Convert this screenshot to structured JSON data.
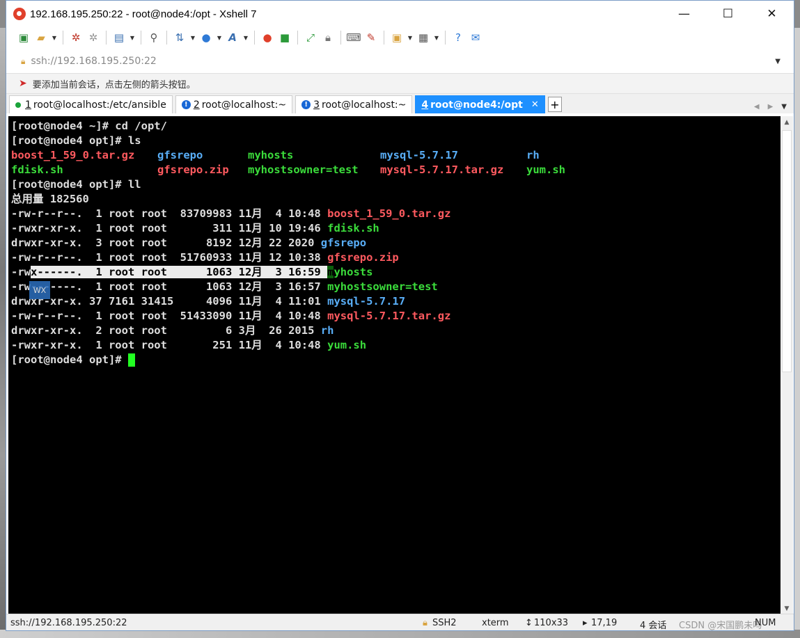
{
  "window": {
    "title": "192.168.195.250:22 - root@node4:/opt - Xshell 7",
    "minimize": "—",
    "maximize": "☐",
    "close": "✕"
  },
  "toolbar": {
    "icons": [
      "new-session-icon",
      "open-folder-icon",
      "connect-icon",
      "disconnect-icon",
      "properties-icon",
      "find-icon",
      "transfer-icon",
      "globe-icon",
      "font-icon",
      "xftp-icon",
      "xshell-green-icon",
      "fullscreen-icon",
      "lock-icon",
      "keyboard-icon",
      "highlight-icon",
      "compose-icon",
      "layout-icon",
      "help-icon",
      "chat-icon"
    ]
  },
  "address": {
    "value": "ssh://192.168.195.250:22"
  },
  "notice": {
    "text": "要添加当前会话，点击左侧的箭头按钮。"
  },
  "tabs": [
    {
      "num": "1",
      "label": "root@localhost:/etc/ansible",
      "status": "connected"
    },
    {
      "num": "2",
      "label": "root@localhost:~",
      "status": "warning"
    },
    {
      "num": "3",
      "label": "root@localhost:~",
      "status": "warning"
    },
    {
      "num": "4",
      "label": "root@node4:/opt",
      "status": "active"
    }
  ],
  "terminal": {
    "cmd1": "[root@node4 ~]# cd /opt/",
    "cmd2": "[root@node4 opt]# ls",
    "ls_row1": {
      "c1": "boost_1_59_0.tar.gz",
      "c2": "gfsrepo",
      "c3": "myhosts",
      "c4": "mysql-5.7.17",
      "c5": "rh"
    },
    "ls_row2": {
      "c1": "fdisk.sh",
      "c2": "gfsrepo.zip",
      "c3": "myhostsowner=test",
      "c4": "mysql-5.7.17.tar.gz",
      "c5": "yum.sh"
    },
    "cmd3": "[root@node4 opt]# ll",
    "total": "总用量 182560",
    "ll": [
      {
        "meta": "-rw-r--r--.  1 root root  83709983 11月  4 10:48 ",
        "name": "boost_1_59_0.tar.gz",
        "color": "red"
      },
      {
        "meta": "-rwxr-xr-x.  1 root root       311 11月 10 19:46 ",
        "name": "fdisk.sh",
        "color": "grn"
      },
      {
        "meta": "drwxr-xr-x.  3 root root      8192 12月 22 2020 ",
        "name": "gfsrepo",
        "color": "blu"
      },
      {
        "meta": "-rw-r--r--.  1 root root  51760933 11月 12 10:38 ",
        "name": "gfsrepo.zip",
        "color": "red"
      },
      {
        "meta_a": "-rw",
        "meta_b": "x------.  1 root root      1063 12月  3 16:59 ",
        "name_a": "m",
        "name_b": "yhosts",
        "color": "grn"
      },
      {
        "meta": "-rw-------.  1 root root      1063 12月  3 16:57 ",
        "name": "myhostsowner=test",
        "color": "grn"
      },
      {
        "meta": "drwxr-xr-x. 37 7161 31415     4096 11月  4 11:01 ",
        "name": "mysql-5.7.17",
        "color": "blu"
      },
      {
        "meta": "-rw-r--r--.  1 root root  51433090 11月  4 10:48 ",
        "name": "mysql-5.7.17.tar.gz",
        "color": "red"
      },
      {
        "meta": "drwxr-xr-x.  2 root root         6 3月  26 2015 ",
        "name": "rh",
        "color": "blu"
      },
      {
        "meta": "-rwxr-xr-x.  1 root root       251 11月  4 10:48 ",
        "name": "yum.sh",
        "color": "grn"
      }
    ],
    "prompt": "[root@node4 opt]# "
  },
  "status": {
    "connection": "ssh://192.168.195.250:22",
    "protocol": "SSH2",
    "term": "xterm",
    "size": "110x33",
    "cursor": "17,19",
    "sessions": "4 会话",
    "watermark": "CSDN @宋国鹏未吗",
    "num": "NUM"
  },
  "overlay": {
    "float_label": "WX"
  }
}
